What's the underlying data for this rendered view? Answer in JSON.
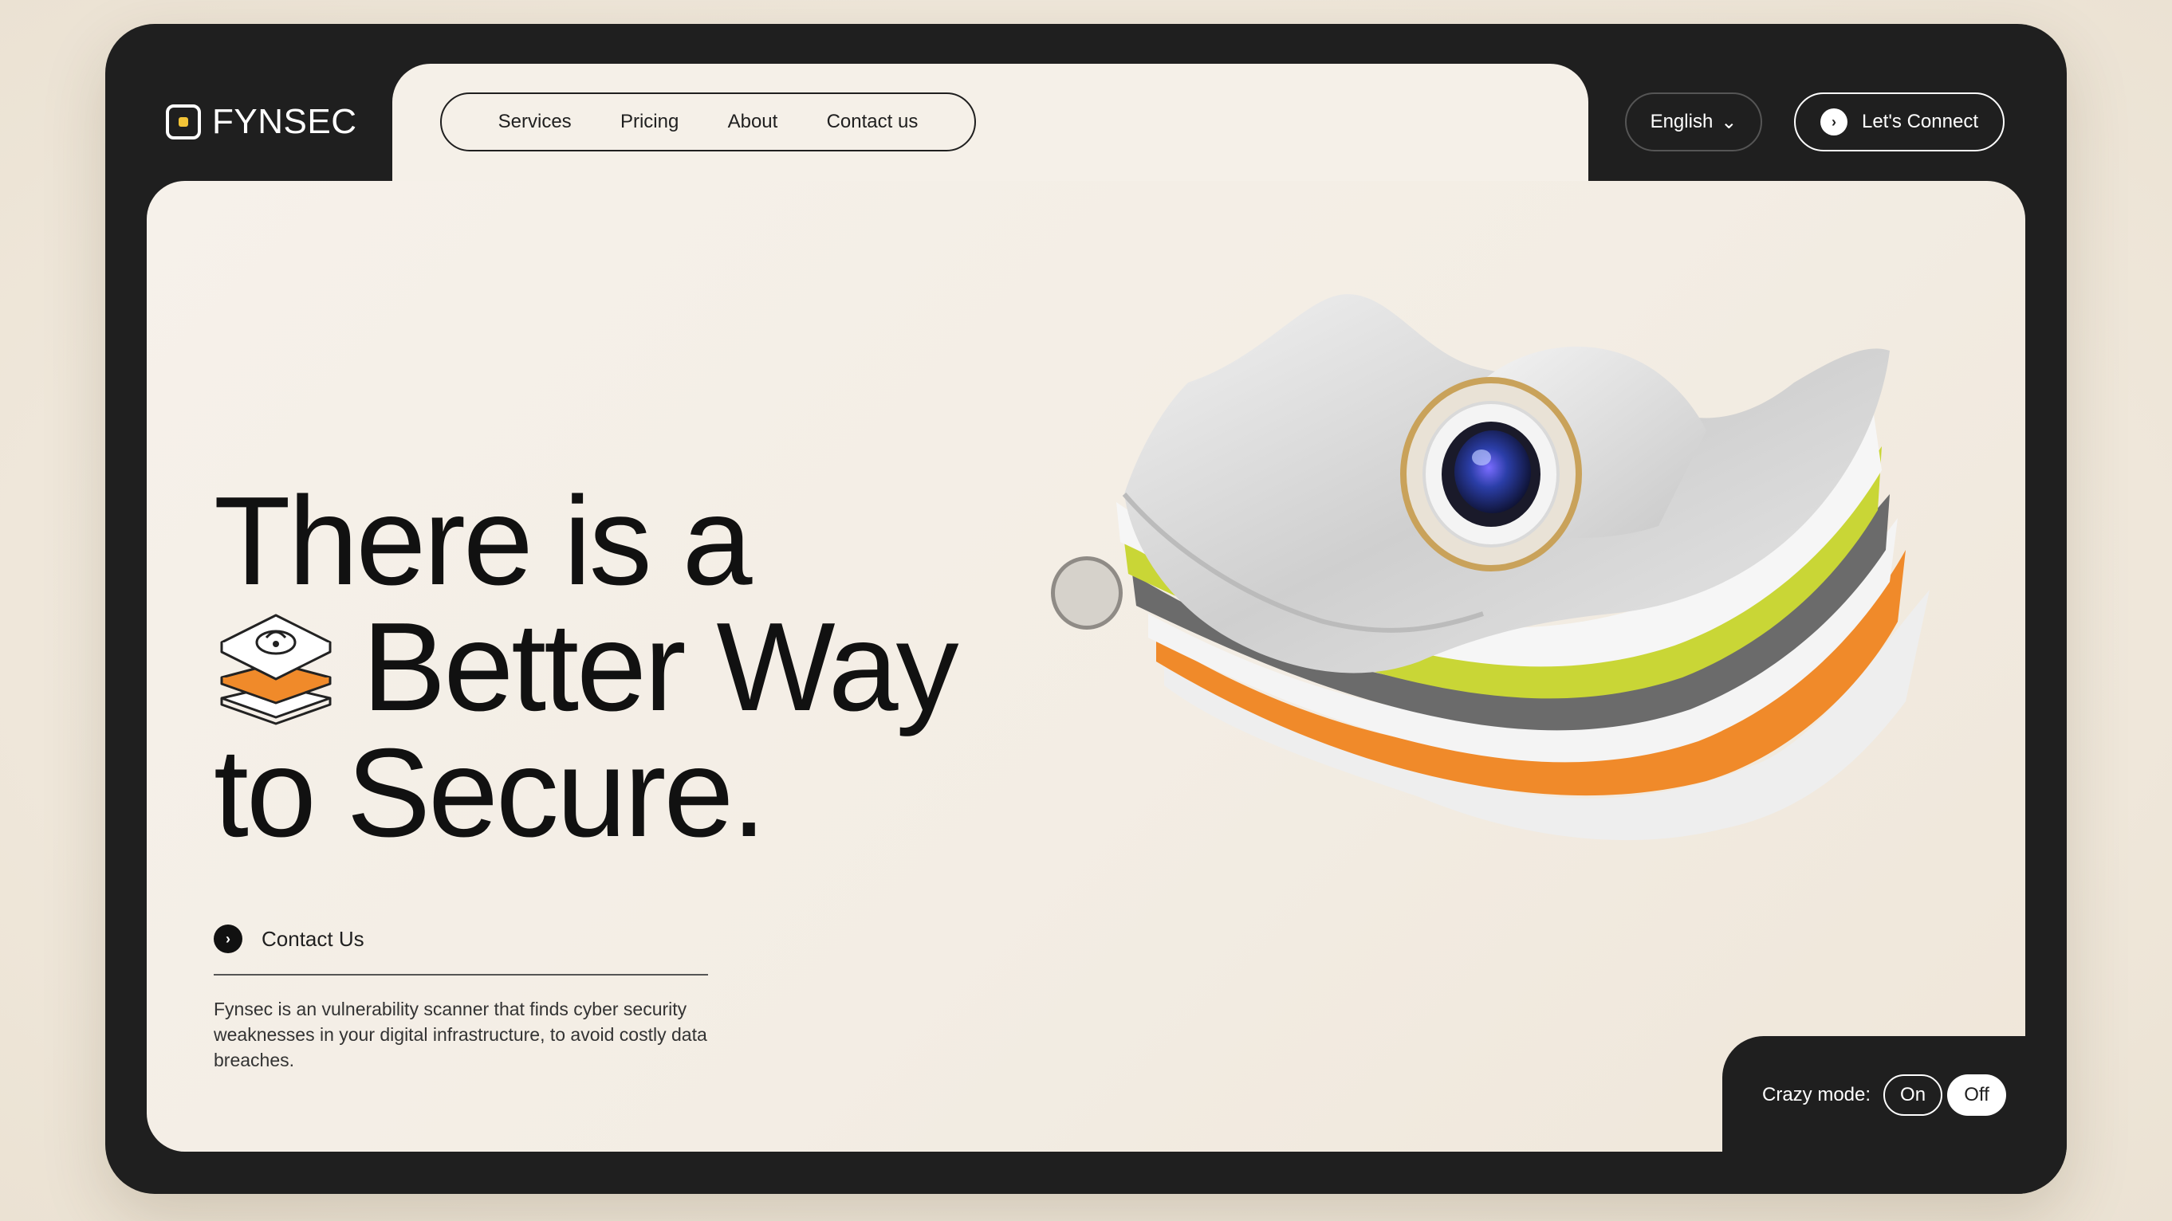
{
  "brand": {
    "name": "FYNSEC"
  },
  "nav": {
    "items": [
      "Services",
      "Pricing",
      "About",
      "Contact us"
    ],
    "language": "English",
    "connect_label": "Let's Connect"
  },
  "hero": {
    "line1": "There is a",
    "line2": "Better Way",
    "line3": "to Secure.",
    "contact_label": "Contact Us",
    "description": "Fynsec is an vulnerability scanner that finds cyber security weaknesses in your digital infrastructure, to avoid costly data breaches."
  },
  "footer": {
    "crazy_mode_label": "Crazy mode:",
    "on_label": "On",
    "off_label": "Off"
  },
  "colors": {
    "frame": "#1f1f1f",
    "panel": "#f5f0e8",
    "accent_orange": "#f08a2a",
    "accent_lime": "#c9d636"
  }
}
